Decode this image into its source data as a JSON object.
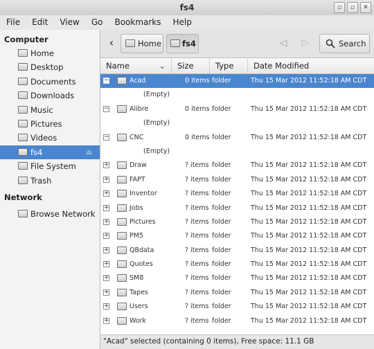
{
  "window": {
    "title": "fs4",
    "controls": [
      "▫",
      "▫",
      "✕"
    ]
  },
  "menu": [
    "File",
    "Edit",
    "View",
    "Go",
    "Bookmarks",
    "Help"
  ],
  "sidebar": {
    "computer_heading": "Computer",
    "places": [
      {
        "label": "Home",
        "icon": "home-folder-icon"
      },
      {
        "label": "Desktop",
        "icon": "desktop-folder-icon"
      },
      {
        "label": "Documents",
        "icon": "documents-folder-icon"
      },
      {
        "label": "Downloads",
        "icon": "downloads-folder-icon"
      },
      {
        "label": "Music",
        "icon": "music-folder-icon"
      },
      {
        "label": "Pictures",
        "icon": "pictures-folder-icon"
      },
      {
        "label": "Videos",
        "icon": "videos-folder-icon"
      },
      {
        "label": "fs4",
        "icon": "network-drive-icon",
        "selected": true,
        "eject": "⏏"
      },
      {
        "label": "File System",
        "icon": "filesystem-icon"
      },
      {
        "label": "Trash",
        "icon": "trash-icon"
      }
    ],
    "network_heading": "Network",
    "network": [
      {
        "label": "Browse Network",
        "icon": "network-icon"
      }
    ]
  },
  "toolbar": {
    "back_glyph": "‹",
    "home_label": "Home",
    "location_label": "fs4",
    "nav_back_glyph": "◁",
    "nav_forward_glyph": "▷",
    "search_label": "Search"
  },
  "columns": {
    "name": "Name",
    "size": "Size",
    "type": "Type",
    "date": "Date Modified",
    "sort_glyph": "⌄"
  },
  "rows": [
    {
      "kind": "folder",
      "name": "Acad",
      "size": "0 items",
      "type": "folder",
      "date": "Thu 15 Mar 2012 11:52:18 AM CDT",
      "expanded": true,
      "selected": true
    },
    {
      "kind": "empty",
      "text": "(Empty)"
    },
    {
      "kind": "folder",
      "name": "Alibre",
      "size": "0 items",
      "type": "folder",
      "date": "Thu 15 Mar 2012 11:52:18 AM CDT",
      "expanded": true
    },
    {
      "kind": "empty",
      "text": "(Empty)"
    },
    {
      "kind": "folder",
      "name": "CNC",
      "size": "0 items",
      "type": "folder",
      "date": "Thu 15 Mar 2012 11:52:18 AM CDT",
      "expanded": true
    },
    {
      "kind": "empty",
      "text": "(Empty)"
    },
    {
      "kind": "folder",
      "name": "Draw",
      "size": "? items",
      "type": "folder",
      "date": "Thu 15 Mar 2012 11:52:18 AM CDT"
    },
    {
      "kind": "folder",
      "name": "FAPT",
      "size": "? items",
      "type": "folder",
      "date": "Thu 15 Mar 2012 11:52:18 AM CDT"
    },
    {
      "kind": "folder",
      "name": "Inventor",
      "size": "? items",
      "type": "folder",
      "date": "Thu 15 Mar 2012 11:52:18 AM CDT"
    },
    {
      "kind": "folder",
      "name": "Jobs",
      "size": "? items",
      "type": "folder",
      "date": "Thu 15 Mar 2012 11:52:18 AM CDT"
    },
    {
      "kind": "folder",
      "name": "Pictures",
      "size": "? items",
      "type": "folder",
      "date": "Thu 15 Mar 2012 11:52:18 AM CDT"
    },
    {
      "kind": "folder",
      "name": "PM5",
      "size": "? items",
      "type": "folder",
      "date": "Thu 15 Mar 2012 11:52:18 AM CDT"
    },
    {
      "kind": "folder",
      "name": "QBdata",
      "size": "? items",
      "type": "folder",
      "date": "Thu 15 Mar 2012 11:52:18 AM CDT"
    },
    {
      "kind": "folder",
      "name": "Quotes",
      "size": "? items",
      "type": "folder",
      "date": "Thu 15 Mar 2012 11:52:18 AM CDT"
    },
    {
      "kind": "folder",
      "name": "SM8",
      "size": "? items",
      "type": "folder",
      "date": "Thu 15 Mar 2012 11:52:18 AM CDT"
    },
    {
      "kind": "folder",
      "name": "Tapes",
      "size": "? items",
      "type": "folder",
      "date": "Thu 15 Mar 2012 11:52:18 AM CDT"
    },
    {
      "kind": "folder",
      "name": "Users",
      "size": "? items",
      "type": "folder",
      "date": "Thu 15 Mar 2012 11:52:18 AM CDT"
    },
    {
      "kind": "folder",
      "name": "Work",
      "size": "? items",
      "type": "folder",
      "date": "Thu 15 Mar 2012 11:52:18 AM CDT"
    }
  ],
  "status": "\"Acad\" selected (containing 0 items), Free space: 11.1 GB",
  "colors": {
    "selection": "#4a86cf",
    "sidebar_bg": "#f3f3f3"
  }
}
